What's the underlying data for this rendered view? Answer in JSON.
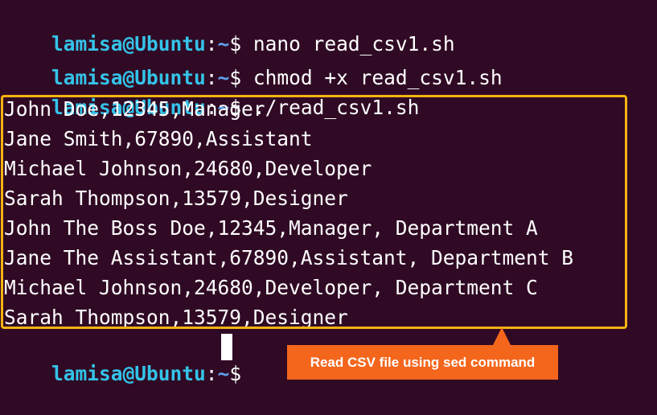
{
  "terminal": {
    "prompt": {
      "user_host": "lamisa@Ubuntu",
      "separator": ":",
      "path": "~",
      "symbol": "$"
    },
    "commands": [
      " nano read_csv1.sh",
      " chmod +x read_csv1.sh",
      " ./read_csv1.sh"
    ],
    "output": [
      "John Doe,12345,Manager",
      "Jane Smith,67890,Assistant",
      "Michael Johnson,24680,Developer",
      "Sarah Thompson,13579,Designer",
      "John The Boss Doe,12345,Manager, Department A",
      "Jane The Assistant,67890,Assistant, Department B",
      "Michael Johnson,24680,Developer, Department C",
      "Sarah Thompson,13579,Designer"
    ]
  },
  "annotation": {
    "callout_text": "Read CSV file using sed command"
  },
  "colors": {
    "background": "#300a24",
    "prompt_user": "#34c3e8",
    "prompt_path": "#5ea0ef",
    "highlight_border": "#f5b312",
    "callout_bg": "#f4661c"
  }
}
